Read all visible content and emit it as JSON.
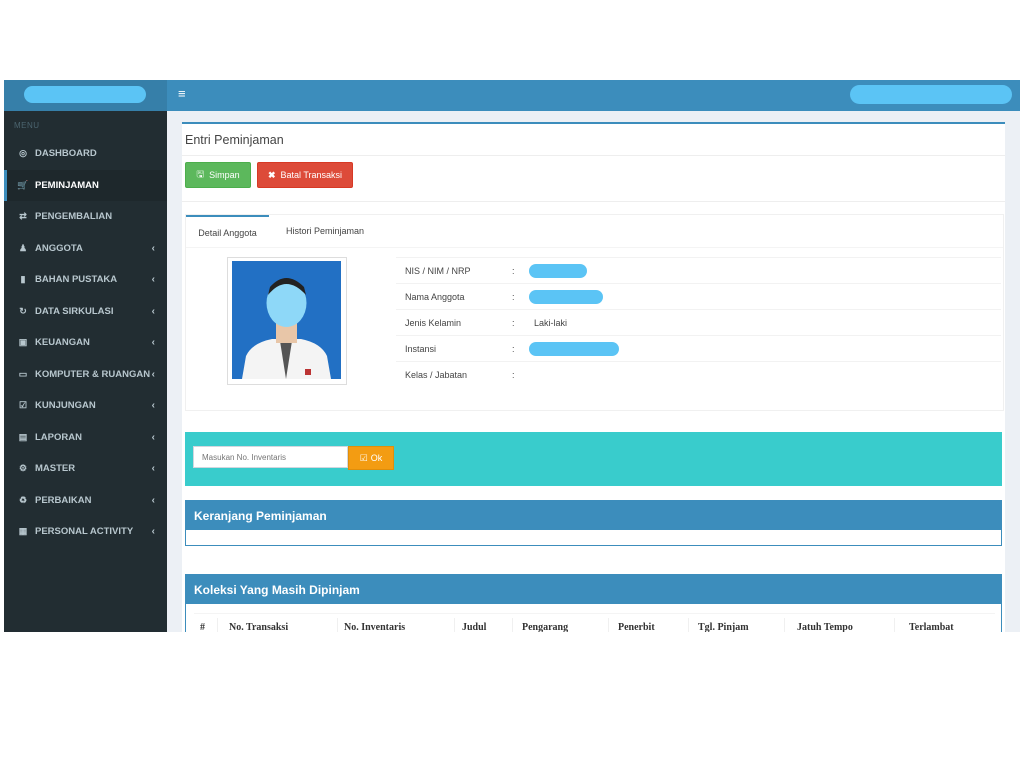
{
  "sidebar": {
    "header": "MENU",
    "items": [
      {
        "label": "DASHBOARD",
        "icon": "dashboard-icon",
        "glyph": "◎",
        "has_children": false,
        "active": false
      },
      {
        "label": "PEMINJAMAN",
        "icon": "cart-icon",
        "glyph": "🛒",
        "has_children": false,
        "active": true
      },
      {
        "label": "PENGEMBALIAN",
        "icon": "exchange-icon",
        "glyph": "⇄",
        "has_children": false,
        "active": false
      },
      {
        "label": "ANGGOTA",
        "icon": "user-icon",
        "glyph": "♟",
        "has_children": true,
        "active": false
      },
      {
        "label": "BAHAN PUSTAKA",
        "icon": "bookmark-icon",
        "glyph": "▮",
        "has_children": true,
        "active": false
      },
      {
        "label": "DATA SIRKULASI",
        "icon": "refresh-icon",
        "glyph": "↻",
        "has_children": true,
        "active": false
      },
      {
        "label": "KEUANGAN",
        "icon": "money-icon",
        "glyph": "▣",
        "has_children": true,
        "active": false
      },
      {
        "label": "KOMPUTER & RUANGAN",
        "icon": "desktop-icon",
        "glyph": "▭",
        "has_children": true,
        "active": false
      },
      {
        "label": "KUNJUNGAN",
        "icon": "checkbox-icon",
        "glyph": "☑",
        "has_children": true,
        "active": false
      },
      {
        "label": "LAPORAN",
        "icon": "file-text-icon",
        "glyph": "▤",
        "has_children": true,
        "active": false
      },
      {
        "label": "MASTER",
        "icon": "cogs-icon",
        "glyph": "⚙",
        "has_children": true,
        "active": false
      },
      {
        "label": "PERBAIKAN",
        "icon": "recycle-icon",
        "glyph": "♻",
        "has_children": true,
        "active": false
      },
      {
        "label": "PERSONAL ACTIVITY",
        "icon": "newspaper-icon",
        "glyph": "▦",
        "has_children": true,
        "active": false
      }
    ]
  },
  "page": {
    "title": "Entri Peminjaman"
  },
  "actions": {
    "save_label": "Simpan",
    "cancel_label": "Batal Transaksi"
  },
  "tabs": [
    "Detail Anggota",
    "Histori Peminjaman"
  ],
  "member": {
    "rows": [
      {
        "label": "NIS / NIM / NRP",
        "value": "",
        "redacted": true
      },
      {
        "label": "Nama Anggota",
        "value": "",
        "redacted": true
      },
      {
        "label": "Jenis Kelamin",
        "value": "Laki-laki",
        "redacted": false
      },
      {
        "label": "Instansi",
        "value": "",
        "redacted": true
      },
      {
        "label": "Kelas / Jabatan",
        "value": "",
        "redacted": false
      }
    ],
    "separator": ":"
  },
  "inventory": {
    "placeholder": "Masukan No. Inventaris",
    "ok_label": "Ok"
  },
  "cart": {
    "title": "Keranjang Peminjaman"
  },
  "borrowed": {
    "title": "Koleksi Yang Masih Dipinjam",
    "columns": [
      "#",
      "No. Transaksi",
      "No. Inventaris",
      "Judul",
      "Pengarang",
      "Penerbit",
      "Tgl. Pinjam",
      "Jatuh Tempo",
      "Terlambat"
    ]
  },
  "colors": {
    "primary": "#3c8dbc",
    "sidebar": "#222d32",
    "success": "#5cb85c",
    "danger": "#dd4b39",
    "warning": "#f39c12",
    "teal": "#39cccc",
    "redaction": "#5bc4f5"
  }
}
